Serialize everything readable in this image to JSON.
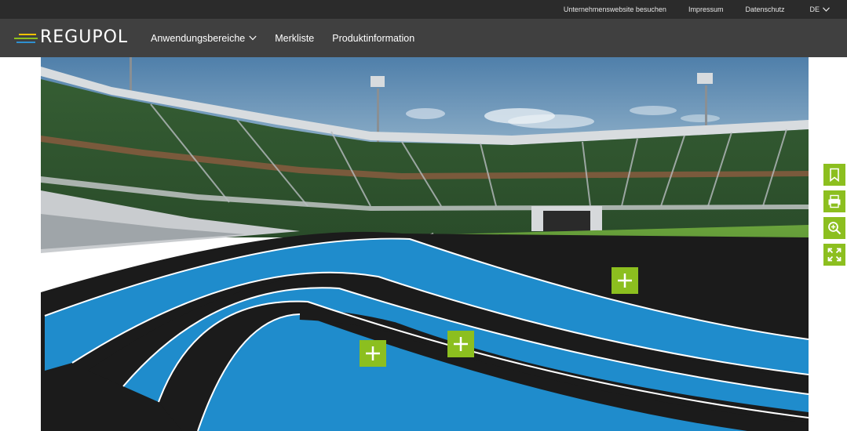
{
  "topbar": {
    "links": [
      "Unternehmenswebsite besuchen",
      "Impressum",
      "Datenschutz"
    ],
    "language": "DE"
  },
  "brand": {
    "name": "REGUPOL",
    "stripe_colors": [
      "#f3c300",
      "#8cbf1f",
      "#2e8fd0"
    ]
  },
  "nav": {
    "items": [
      "Anwendungsbereiche",
      "Merkliste",
      "Produktinformation"
    ]
  },
  "hero": {
    "hotspot_count": 3
  },
  "tools": [
    "bookmark-icon",
    "print-icon",
    "zoom-in-icon",
    "fullscreen-icon"
  ],
  "colors": {
    "accent": "#8cbf1f",
    "topbar": "#2b2b2b",
    "nav": "#3a3a3a",
    "track_blue": "#1f8ccc",
    "track_black": "#1b1b1b",
    "field_blue": "#2c3f8c",
    "grass": "#5f9a36"
  }
}
